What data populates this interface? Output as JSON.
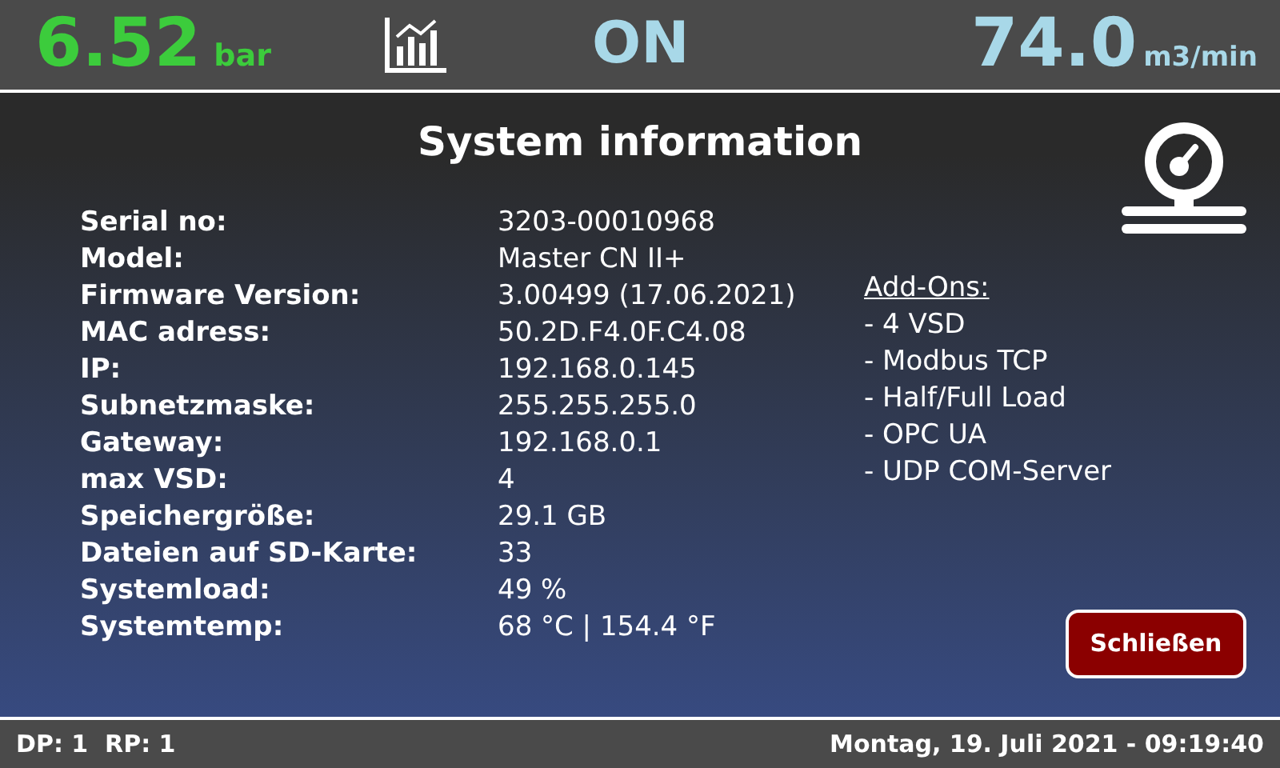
{
  "header": {
    "pressure": {
      "value": "6.52",
      "unit": "bar"
    },
    "state": "ON",
    "flow": {
      "value": "74.0",
      "unit": "m3/min"
    }
  },
  "title": "System information",
  "info": [
    {
      "label": "Serial no:",
      "value": "3203-00010968"
    },
    {
      "label": "Model:",
      "value": "Master CN II+"
    },
    {
      "label": "Firmware Version:",
      "value": "3.00499 (17.06.2021)"
    },
    {
      "label": "MAC adress:",
      "value": "50.2D.F4.0F.C4.08"
    },
    {
      "label": "IP:",
      "value": "192.168.0.145"
    },
    {
      "label": "Subnetzmaske:",
      "value": "255.255.255.0"
    },
    {
      "label": "Gateway:",
      "value": "192.168.0.1"
    },
    {
      "label": "max VSD:",
      "value": "4"
    },
    {
      "label": "Speichergröße:",
      "value": "29.1 GB"
    },
    {
      "label": "Dateien auf SD-Karte:",
      "value": "33"
    },
    {
      "label": "Systemload:",
      "value": "49 %"
    },
    {
      "label": "Systemtemp:",
      "value": "68 °C | 154.4 °F"
    }
  ],
  "addons": {
    "heading": "Add-Ons:",
    "items": [
      "- 4 VSD",
      "- Modbus TCP",
      "- Half/Full Load",
      "- OPC UA",
      "- UDP COM-Server"
    ]
  },
  "close_button": "Schließen",
  "status_bar": {
    "left": "DP: 1  RP: 1",
    "datetime": "Montag, 19. Juli 2021 - 09:19:40"
  }
}
